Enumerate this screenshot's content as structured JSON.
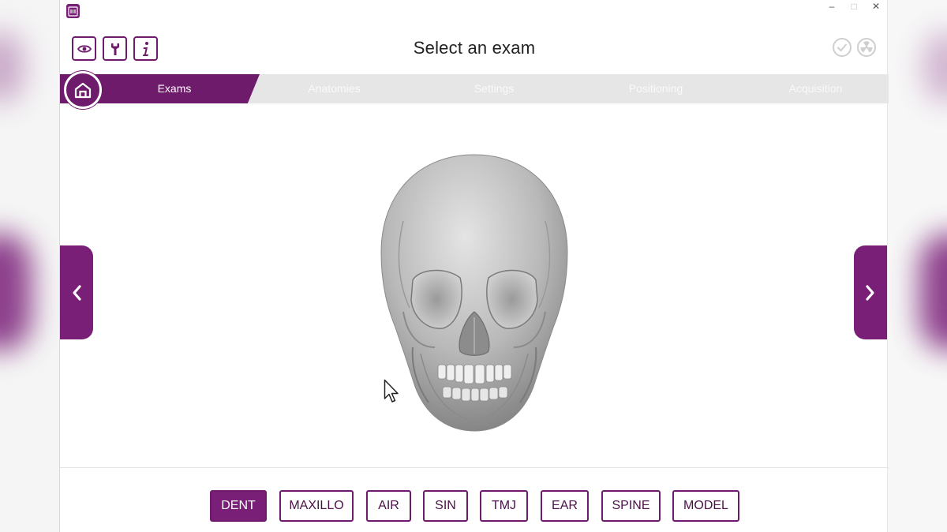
{
  "window": {
    "title": "Select an exam",
    "controls": {
      "minimize": "–",
      "maximize": "□",
      "close": "✕"
    }
  },
  "toolbar": {
    "buttons": [
      {
        "name": "view",
        "icon": "eye-icon"
      },
      {
        "name": "tools",
        "icon": "wrench-icon"
      },
      {
        "name": "info",
        "icon": "info-icon"
      }
    ],
    "status_icons": [
      "check-circle-icon",
      "radiation-icon"
    ]
  },
  "steps": {
    "home_icon": "home-icon",
    "items": [
      {
        "label": "Exams",
        "active": true
      },
      {
        "label": "Anatomies",
        "active": false
      },
      {
        "label": "Settings",
        "active": false
      },
      {
        "label": "Positioning",
        "active": false
      },
      {
        "label": "Acquisition",
        "active": false
      }
    ]
  },
  "viewer": {
    "model": "skull-3d-model",
    "prev_icon": "chevron-left-icon",
    "next_icon": "chevron-right-icon"
  },
  "exams": {
    "selected": "DENT",
    "buttons": [
      "DENT",
      "MAXILLO",
      "AIR",
      "SIN",
      "TMJ",
      "EAR",
      "SPINE",
      "MODEL"
    ]
  },
  "colors": {
    "accent": "#7a1f78",
    "accent_dark": "#6e1b6b",
    "steps_bg": "#e6e6e6",
    "text": "#222222"
  }
}
